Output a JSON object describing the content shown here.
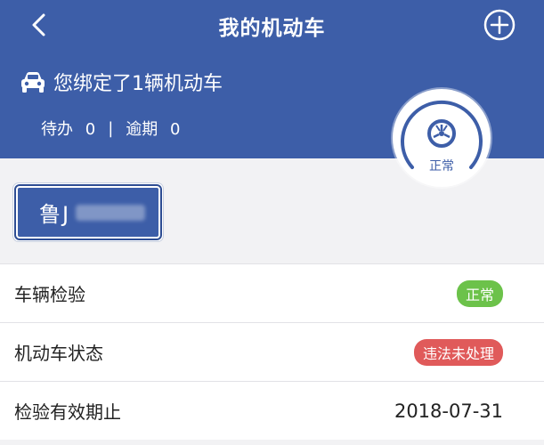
{
  "header": {
    "title": "我的机动车",
    "back_icon": "chevron-left-icon",
    "add_icon": "plus-circle-icon",
    "bound_text": "您绑定了1辆机动车",
    "pending_label": "待办",
    "pending_count": "0",
    "separator": "|",
    "overdue_label": "逾期",
    "overdue_count": "0",
    "bg_color": "#3d5ea8"
  },
  "gauge": {
    "status": "正常",
    "icon": "wheel-icon"
  },
  "plate": {
    "prefix": "鲁J"
  },
  "rows": [
    {
      "label": "车辆检验",
      "badge": "正常",
      "badge_color": "#6cc24a"
    },
    {
      "label": "机动车状态",
      "badge": "违法未处理",
      "badge_color": "#e05a5a"
    },
    {
      "label": "检验有效期止",
      "value": "2018-07-31"
    }
  ]
}
